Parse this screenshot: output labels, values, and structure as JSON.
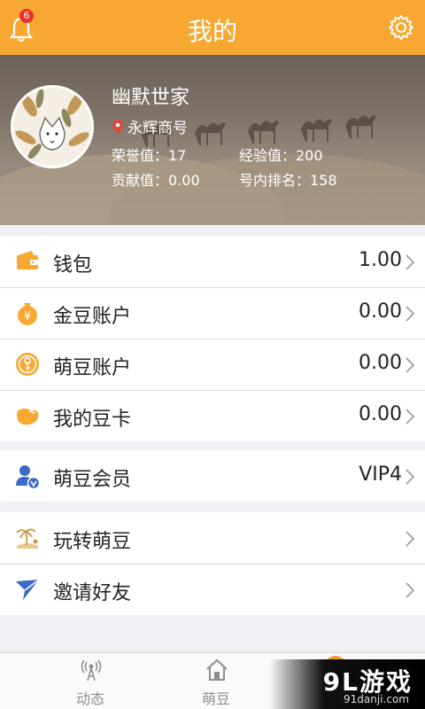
{
  "header": {
    "title": "我的",
    "notification_count": "6"
  },
  "profile": {
    "name": "幽默世家",
    "group": "永辉商号",
    "honor_label": "荣誉值：17",
    "exp_label": "经验值：200",
    "contribution_label": "贡献值：0.00",
    "rank_label": "号内排名：158"
  },
  "accounts": [
    {
      "label": "钱包",
      "value": "1.00",
      "icon": "wallet-icon"
    },
    {
      "label": "金豆账户",
      "value": "0.00",
      "icon": "money-bag-icon"
    },
    {
      "label": "萌豆账户",
      "value": "0.00",
      "icon": "key-coin-icon"
    },
    {
      "label": "我的豆卡",
      "value": "0.00",
      "icon": "bean-card-icon"
    }
  ],
  "membership": {
    "label": "萌豆会员",
    "value": "VIP4",
    "icon": "vip-user-icon"
  },
  "more": [
    {
      "label": "玩转萌豆",
      "icon": "beach-icon"
    },
    {
      "label": "邀请好友",
      "icon": "paper-plane-icon"
    }
  ],
  "tabbar": {
    "tabs": [
      {
        "label": "动态",
        "icon": "broadcast-icon"
      },
      {
        "label": "萌豆",
        "icon": "home-icon"
      }
    ]
  },
  "watermark": {
    "brand": "9L游戏",
    "url": "91danji.com"
  },
  "colors": {
    "accent": "#f7a832",
    "badge": "#e8332b"
  }
}
